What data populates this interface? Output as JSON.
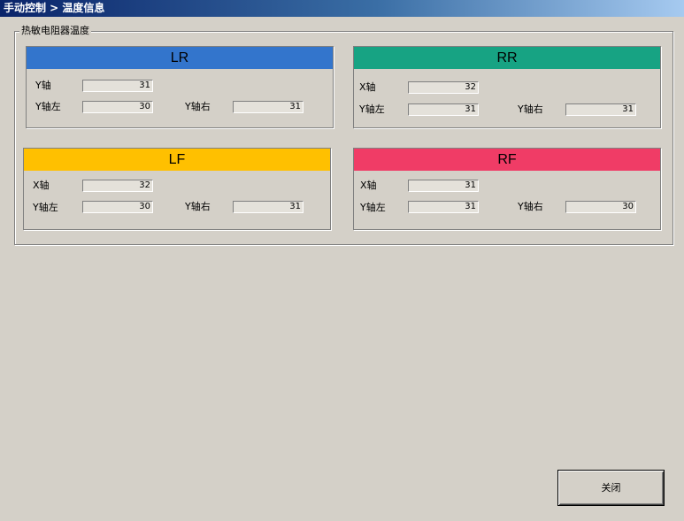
{
  "window": {
    "title": "手动控制 > 温度信息"
  },
  "group": {
    "label": "热敏电阻器温度"
  },
  "panels": {
    "lr": {
      "title": "LR",
      "color": "#3375cc",
      "row1_label": "Y轴",
      "row1_value": "31",
      "left_label": "Y轴左",
      "left_value": "30",
      "right_label": "Y轴右",
      "right_value": "31"
    },
    "rr": {
      "title": "RR",
      "color": "#17a383",
      "row1_label": "X轴",
      "row1_value": "32",
      "left_label": "Y轴左",
      "left_value": "31",
      "right_label": "Y轴右",
      "right_value": "31"
    },
    "lf": {
      "title": "LF",
      "color": "#ffc000",
      "row1_label": "X轴",
      "row1_value": "32",
      "left_label": "Y轴左",
      "left_value": "30",
      "right_label": "Y轴右",
      "right_value": "31"
    },
    "rf": {
      "title": "RF",
      "color": "#f03c66",
      "row1_label": "X轴",
      "row1_value": "31",
      "left_label": "Y轴左",
      "left_value": "31",
      "right_label": "Y轴右",
      "right_value": "30"
    }
  },
  "buttons": {
    "close_label": "关闭"
  }
}
